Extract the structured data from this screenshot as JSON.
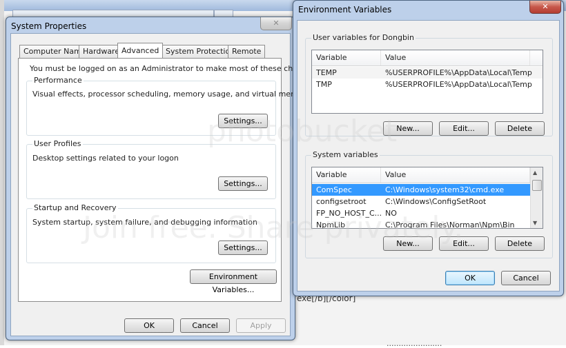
{
  "background": {
    "partial_bottom_text": "exe[/b][/color]",
    "partial_footer_text": "......................."
  },
  "system_properties": {
    "title": "System Properties",
    "tabs": [
      {
        "label": "Computer Name"
      },
      {
        "label": "Hardware"
      },
      {
        "label": "Advanced"
      },
      {
        "label": "System Protection"
      },
      {
        "label": "Remote"
      }
    ],
    "admin_notice": "You must be logged on as an Administrator to make most of these changes.",
    "performance": {
      "legend": "Performance",
      "description": "Visual effects, processor scheduling, memory usage, and virtual memory",
      "settings_label": "Settings..."
    },
    "user_profiles": {
      "legend": "User Profiles",
      "description": "Desktop settings related to your logon",
      "settings_label": "Settings..."
    },
    "startup_recovery": {
      "legend": "Startup and Recovery",
      "description": "System startup, system failure, and debugging information",
      "settings_label": "Settings..."
    },
    "env_vars_label": "Environment Variables...",
    "ok_label": "OK",
    "cancel_label": "Cancel",
    "apply_label": "Apply"
  },
  "environment_variables": {
    "title": "Environment Variables",
    "user_section": {
      "legend": "User variables for Dongbin",
      "columns": [
        "Variable",
        "Value"
      ],
      "rows": [
        {
          "variable": "TEMP",
          "value": "%USERPROFILE%\\AppData\\Local\\Temp"
        },
        {
          "variable": "TMP",
          "value": "%USERPROFILE%\\AppData\\Local\\Temp"
        }
      ],
      "new_label": "New...",
      "edit_label": "Edit...",
      "delete_label": "Delete"
    },
    "system_section": {
      "legend": "System variables",
      "columns": [
        "Variable",
        "Value"
      ],
      "rows": [
        {
          "variable": "ComSpec",
          "value": "C:\\Windows\\system32\\cmd.exe"
        },
        {
          "variable": "configsetroot",
          "value": "C:\\Windows\\ConfigSetRoot"
        },
        {
          "variable": "FP_NO_HOST_C...",
          "value": "NO"
        },
        {
          "variable": "NpmLib",
          "value": "C:\\Program Files\\Norman\\Npm\\Bin"
        }
      ],
      "new_label": "New...",
      "edit_label": "Edit...",
      "delete_label": "Delete"
    },
    "ok_label": "OK",
    "cancel_label": "Cancel"
  },
  "watermark": {
    "line1": "photobucket",
    "line2": "Join free. Share privately."
  },
  "colors": {
    "selection": "#3399ff",
    "frame": "#bdd0ea",
    "close": "#c7574a"
  }
}
